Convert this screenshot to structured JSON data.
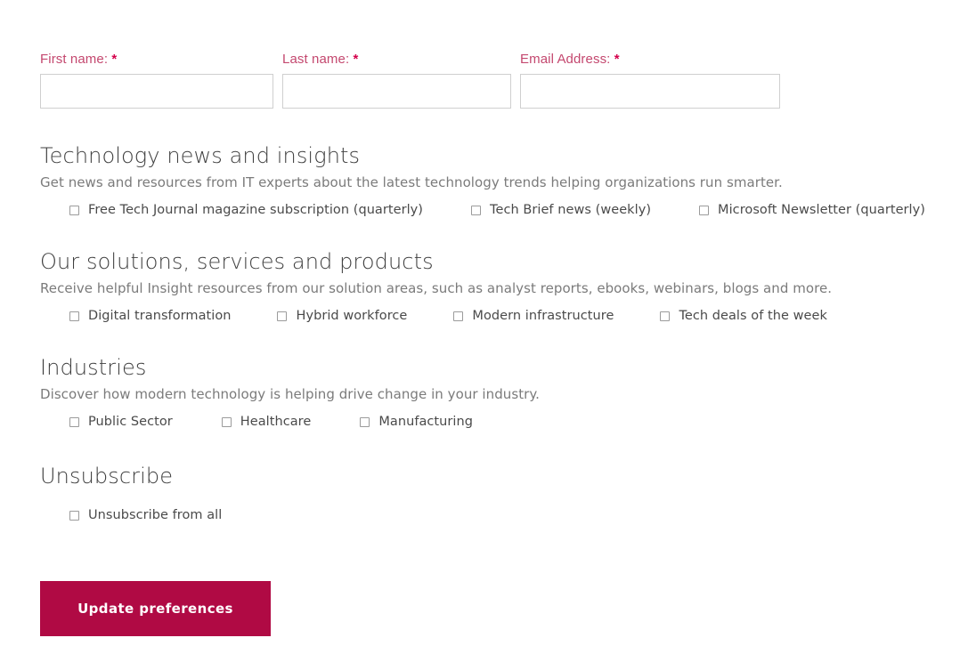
{
  "form": {
    "fields": [
      {
        "name": "first-name",
        "label": "First name:",
        "required_mark": "*",
        "value": "",
        "placeholder": ""
      },
      {
        "name": "last-name",
        "label": "Last name:",
        "required_mark": "*",
        "value": "",
        "placeholder": ""
      },
      {
        "name": "email-address",
        "label": "Email Address:",
        "required_mark": "*",
        "value": "",
        "placeholder": ""
      }
    ],
    "sections": [
      {
        "id": "technology-news",
        "title": "Technology news and insights",
        "description": "Get news and resources from IT experts about the latest technology trends helping organizations run smarter.",
        "options": [
          {
            "label": "Free Tech Journal magazine subscription (quarterly)",
            "checked": false
          },
          {
            "label": "Tech Brief news (weekly)",
            "checked": false
          },
          {
            "label": "Microsoft Newsletter (quarterly)",
            "checked": false
          }
        ]
      },
      {
        "id": "solutions-services-products",
        "title": "Our solutions, services and products",
        "description": "Receive helpful Insight resources from our solution areas, such as analyst reports, ebooks, webinars, blogs and more.",
        "options": [
          {
            "label": "Digital transformation",
            "checked": false
          },
          {
            "label": "Hybrid workforce",
            "checked": false
          },
          {
            "label": "Modern infrastructure",
            "checked": false
          },
          {
            "label": "Tech deals of the week",
            "checked": false
          }
        ]
      },
      {
        "id": "industries",
        "title": "Industries",
        "description": "Discover how modern technology is helping drive change in your industry.",
        "options": [
          {
            "label": "Public Sector",
            "checked": false
          },
          {
            "label": "Healthcare",
            "checked": false
          },
          {
            "label": "Manufacturing",
            "checked": false
          }
        ]
      },
      {
        "id": "unsubscribe",
        "title": "Unsubscribe",
        "description": "",
        "options": [
          {
            "label": "Unsubscribe from all",
            "checked": false
          }
        ]
      }
    ],
    "submit_label": "Update preferences"
  },
  "colors": {
    "label": "#c4486f",
    "required": "#d4004b",
    "button_background": "#b00a44",
    "button_text": "#ffffff",
    "heading": "#3f3f3f",
    "description": "#7b7b7b",
    "option_label": "#4a4a4a",
    "input_border": "#cfcfcf",
    "checkbox_border": "#9b9b9b"
  }
}
